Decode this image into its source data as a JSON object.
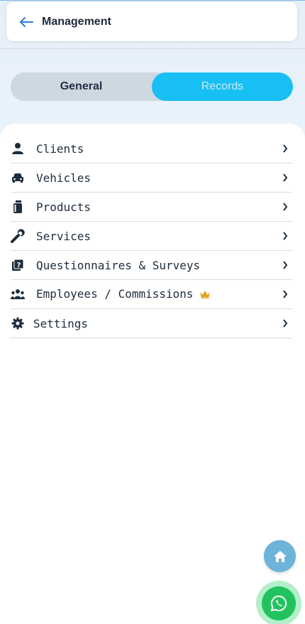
{
  "header": {
    "title": "Management",
    "back_icon": "arrow-left-icon"
  },
  "tabs": [
    {
      "label": "General",
      "active": false
    },
    {
      "label": "Records",
      "active": true
    }
  ],
  "menu": {
    "items": [
      {
        "label": "Clients",
        "icon": "person-icon"
      },
      {
        "label": "Vehicles",
        "icon": "car-icon"
      },
      {
        "label": "Products",
        "icon": "product-box-icon"
      },
      {
        "label": "Services",
        "icon": "wrench-icon"
      },
      {
        "label": "Questionnaires & Surveys",
        "icon": "question-book-icon"
      },
      {
        "label": "Employees / Commissions",
        "icon": "people-icon",
        "badge": "crown-icon"
      },
      {
        "label": "Settings",
        "icon": "gear-icon"
      }
    ]
  },
  "fabs": {
    "home_icon": "home-icon",
    "whatsapp_icon": "whatsapp-icon"
  },
  "colors": {
    "accent": "#17bff5",
    "tab_inactive": "#cdd8e1",
    "home_fab": "#6eb3da",
    "whatsapp": "#22c35e",
    "crown": "#e0a321"
  }
}
